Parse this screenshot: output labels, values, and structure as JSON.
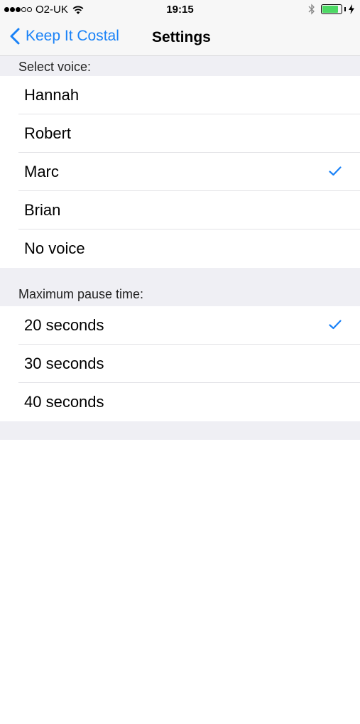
{
  "status_bar": {
    "signal_filled": 3,
    "signal_empty": 2,
    "carrier": "O2-UK",
    "time": "19:15",
    "battery_level": 0.85,
    "battery_color": "#4cd964",
    "icons": [
      "wifi-icon",
      "bluetooth-icon",
      "battery-icon",
      "charging-bolt-icon"
    ]
  },
  "nav": {
    "back_label": "Keep It Costal",
    "title": "Settings",
    "accent": "#1a82f7"
  },
  "voice_section": {
    "header": "Select voice:",
    "options": [
      {
        "label": "Hannah",
        "selected": false
      },
      {
        "label": "Robert",
        "selected": false
      },
      {
        "label": "Marc",
        "selected": true
      },
      {
        "label": "Brian",
        "selected": false
      },
      {
        "label": "No voice",
        "selected": false
      }
    ]
  },
  "pause_section": {
    "header": "Maximum pause time:",
    "options": [
      {
        "label": "20 seconds",
        "selected": true
      },
      {
        "label": "30 seconds",
        "selected": false
      },
      {
        "label": "40 seconds",
        "selected": false
      }
    ]
  }
}
